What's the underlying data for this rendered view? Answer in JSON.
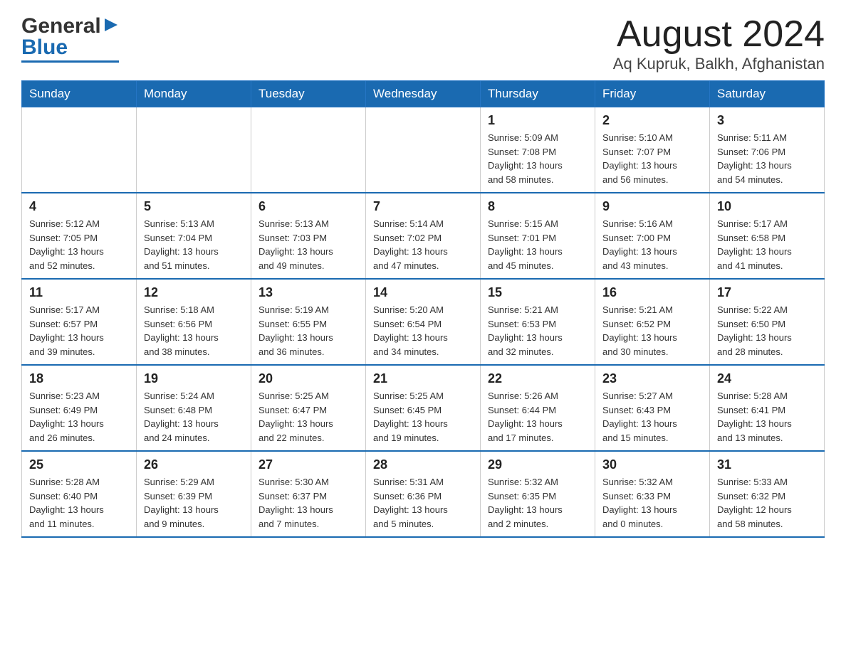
{
  "header": {
    "logo_general": "General",
    "logo_blue": "Blue",
    "month_title": "August 2024",
    "location": "Aq Kupruk, Balkh, Afghanistan"
  },
  "days_of_week": [
    "Sunday",
    "Monday",
    "Tuesday",
    "Wednesday",
    "Thursday",
    "Friday",
    "Saturday"
  ],
  "weeks": [
    [
      {
        "day": "",
        "info": ""
      },
      {
        "day": "",
        "info": ""
      },
      {
        "day": "",
        "info": ""
      },
      {
        "day": "",
        "info": ""
      },
      {
        "day": "1",
        "info": "Sunrise: 5:09 AM\nSunset: 7:08 PM\nDaylight: 13 hours\nand 58 minutes."
      },
      {
        "day": "2",
        "info": "Sunrise: 5:10 AM\nSunset: 7:07 PM\nDaylight: 13 hours\nand 56 minutes."
      },
      {
        "day": "3",
        "info": "Sunrise: 5:11 AM\nSunset: 7:06 PM\nDaylight: 13 hours\nand 54 minutes."
      }
    ],
    [
      {
        "day": "4",
        "info": "Sunrise: 5:12 AM\nSunset: 7:05 PM\nDaylight: 13 hours\nand 52 minutes."
      },
      {
        "day": "5",
        "info": "Sunrise: 5:13 AM\nSunset: 7:04 PM\nDaylight: 13 hours\nand 51 minutes."
      },
      {
        "day": "6",
        "info": "Sunrise: 5:13 AM\nSunset: 7:03 PM\nDaylight: 13 hours\nand 49 minutes."
      },
      {
        "day": "7",
        "info": "Sunrise: 5:14 AM\nSunset: 7:02 PM\nDaylight: 13 hours\nand 47 minutes."
      },
      {
        "day": "8",
        "info": "Sunrise: 5:15 AM\nSunset: 7:01 PM\nDaylight: 13 hours\nand 45 minutes."
      },
      {
        "day": "9",
        "info": "Sunrise: 5:16 AM\nSunset: 7:00 PM\nDaylight: 13 hours\nand 43 minutes."
      },
      {
        "day": "10",
        "info": "Sunrise: 5:17 AM\nSunset: 6:58 PM\nDaylight: 13 hours\nand 41 minutes."
      }
    ],
    [
      {
        "day": "11",
        "info": "Sunrise: 5:17 AM\nSunset: 6:57 PM\nDaylight: 13 hours\nand 39 minutes."
      },
      {
        "day": "12",
        "info": "Sunrise: 5:18 AM\nSunset: 6:56 PM\nDaylight: 13 hours\nand 38 minutes."
      },
      {
        "day": "13",
        "info": "Sunrise: 5:19 AM\nSunset: 6:55 PM\nDaylight: 13 hours\nand 36 minutes."
      },
      {
        "day": "14",
        "info": "Sunrise: 5:20 AM\nSunset: 6:54 PM\nDaylight: 13 hours\nand 34 minutes."
      },
      {
        "day": "15",
        "info": "Sunrise: 5:21 AM\nSunset: 6:53 PM\nDaylight: 13 hours\nand 32 minutes."
      },
      {
        "day": "16",
        "info": "Sunrise: 5:21 AM\nSunset: 6:52 PM\nDaylight: 13 hours\nand 30 minutes."
      },
      {
        "day": "17",
        "info": "Sunrise: 5:22 AM\nSunset: 6:50 PM\nDaylight: 13 hours\nand 28 minutes."
      }
    ],
    [
      {
        "day": "18",
        "info": "Sunrise: 5:23 AM\nSunset: 6:49 PM\nDaylight: 13 hours\nand 26 minutes."
      },
      {
        "day": "19",
        "info": "Sunrise: 5:24 AM\nSunset: 6:48 PM\nDaylight: 13 hours\nand 24 minutes."
      },
      {
        "day": "20",
        "info": "Sunrise: 5:25 AM\nSunset: 6:47 PM\nDaylight: 13 hours\nand 22 minutes."
      },
      {
        "day": "21",
        "info": "Sunrise: 5:25 AM\nSunset: 6:45 PM\nDaylight: 13 hours\nand 19 minutes."
      },
      {
        "day": "22",
        "info": "Sunrise: 5:26 AM\nSunset: 6:44 PM\nDaylight: 13 hours\nand 17 minutes."
      },
      {
        "day": "23",
        "info": "Sunrise: 5:27 AM\nSunset: 6:43 PM\nDaylight: 13 hours\nand 15 minutes."
      },
      {
        "day": "24",
        "info": "Sunrise: 5:28 AM\nSunset: 6:41 PM\nDaylight: 13 hours\nand 13 minutes."
      }
    ],
    [
      {
        "day": "25",
        "info": "Sunrise: 5:28 AM\nSunset: 6:40 PM\nDaylight: 13 hours\nand 11 minutes."
      },
      {
        "day": "26",
        "info": "Sunrise: 5:29 AM\nSunset: 6:39 PM\nDaylight: 13 hours\nand 9 minutes."
      },
      {
        "day": "27",
        "info": "Sunrise: 5:30 AM\nSunset: 6:37 PM\nDaylight: 13 hours\nand 7 minutes."
      },
      {
        "day": "28",
        "info": "Sunrise: 5:31 AM\nSunset: 6:36 PM\nDaylight: 13 hours\nand 5 minutes."
      },
      {
        "day": "29",
        "info": "Sunrise: 5:32 AM\nSunset: 6:35 PM\nDaylight: 13 hours\nand 2 minutes."
      },
      {
        "day": "30",
        "info": "Sunrise: 5:32 AM\nSunset: 6:33 PM\nDaylight: 13 hours\nand 0 minutes."
      },
      {
        "day": "31",
        "info": "Sunrise: 5:33 AM\nSunset: 6:32 PM\nDaylight: 12 hours\nand 58 minutes."
      }
    ]
  ]
}
